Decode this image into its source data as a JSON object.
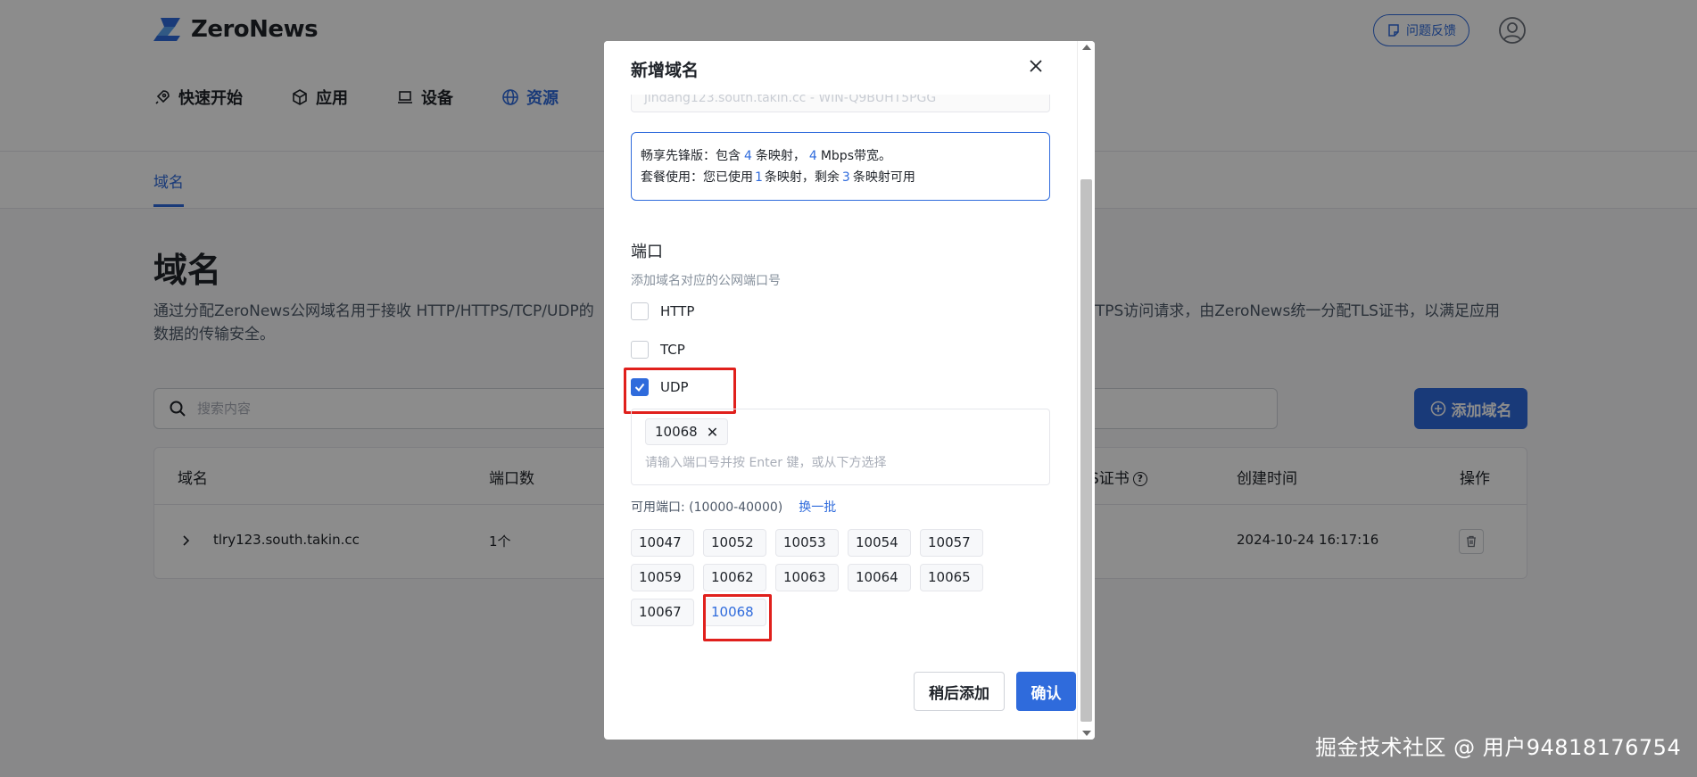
{
  "app": {
    "name": "ZeroNews"
  },
  "header": {
    "nav": [
      {
        "label": "快速开始",
        "icon": "rocket-icon",
        "active": false
      },
      {
        "label": "应用",
        "icon": "cube-icon",
        "active": false
      },
      {
        "label": "设备",
        "icon": "laptop-icon",
        "active": false
      },
      {
        "label": "资源",
        "icon": "globe-icon",
        "active": true
      }
    ],
    "feedback_label": "问题反馈"
  },
  "subtabs": {
    "active": "域名"
  },
  "main": {
    "title": "域名",
    "description": "通过分配ZeroNews公网域名用于接收 HTTP/HTTPS/TCP/UDP的",
    "description_right": "TTPS访问请求，由ZeroNews统一分配TLS证书，以满足应用",
    "description_line2": "数据的传输安全。",
    "search_placeholder": "搜索内容",
    "add_button": "添加域名"
  },
  "table": {
    "headers": {
      "domain": "域名",
      "ports": "端口数",
      "tls": "S证书",
      "created": "创建时间",
      "actions": "操作"
    },
    "rows": [
      {
        "domain": "tlry123.south.takin.cc",
        "ports": "1个",
        "created": "2024-10-24 16:17:16"
      }
    ]
  },
  "modal": {
    "title": "新增域名",
    "cut_input": "jindang123.south.takin.cc - WIN-Q9BUHT5PGG",
    "plan": {
      "line1_prefix": "畅享先锋版：包含",
      "mappings": "4",
      "line1_mid": "条映射，",
      "bandwidth": "4",
      "line1_suffix": "Mbps带宽。",
      "line2_prefix": "套餐使用：您已使用",
      "used": "1",
      "line2_mid": "条映射，剩余",
      "remaining": "3",
      "line2_suffix": "条映射可用"
    },
    "port_section_title": "端口",
    "port_section_sub": "添加域名对应的公网端口号",
    "protocols": [
      {
        "label": "HTTP",
        "checked": false
      },
      {
        "label": "TCP",
        "checked": false
      },
      {
        "label": "UDP",
        "checked": true
      }
    ],
    "selected_tag": "10068",
    "port_input_placeholder": "请输入端口号并按 Enter 键，或从下方选择",
    "available_label": "可用端口:",
    "available_range": "(10000-40000)",
    "refresh_label": "换一批",
    "ports": [
      "10047",
      "10052",
      "10053",
      "10054",
      "10057",
      "10059",
      "10062",
      "10063",
      "10064",
      "10065",
      "10067",
      "10068"
    ],
    "selected_port": "10068",
    "later_label": "稍后添加",
    "confirm_label": "确认"
  },
  "watermark": "掘金技术社区 @ 用户94818176754",
  "colors": {
    "accent": "#2f6bdc",
    "highlight": "#e0201c",
    "overlay": "rgba(0,0,0,0.45)"
  }
}
